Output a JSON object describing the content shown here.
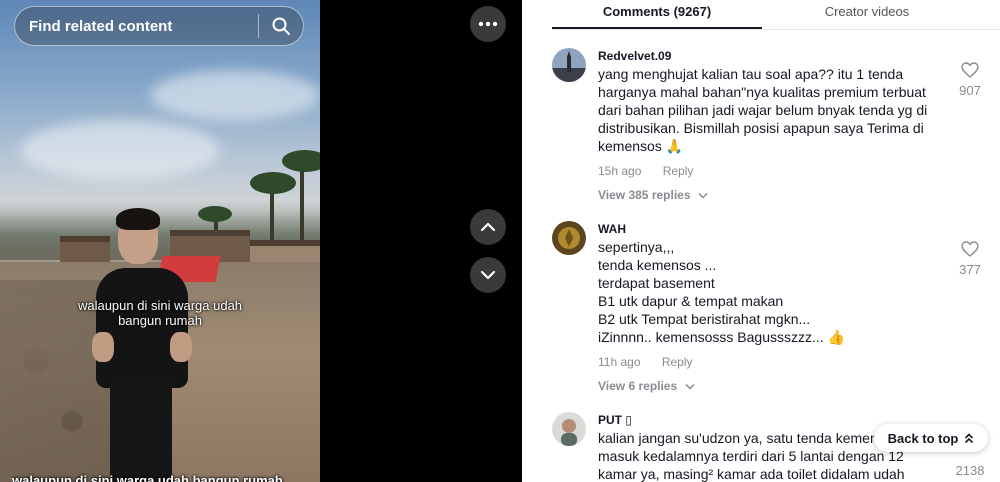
{
  "video": {
    "search_placeholder": "Find related content",
    "caption_overlay": "walaupun di sini warga udah\nbangun rumah",
    "caption_bottom": "walaupun di sini warga udah bangun rumah"
  },
  "tabs": [
    {
      "label": "Comments (9267)",
      "active": true
    },
    {
      "label": "Creator videos",
      "active": false
    }
  ],
  "comments": [
    {
      "user": "Redvelvet.09",
      "text": "yang menghujat kalian tau soal apa?? itu 1 tenda harganya mahal bahan\"nya kualitas premium terbuat dari bahan pilihan jadi wajar belum bnyak tenda yg di distribusikan. Bismillah posisi apapun saya Terima di kemensos 🙏",
      "time": "15h ago",
      "reply_label": "Reply",
      "view_replies": "View 385 replies",
      "likes": "907"
    },
    {
      "user": "WAH",
      "text": "sepertinya,,,\ntenda kemensos ...\nterdapat basement\nB1 utk dapur & tempat makan\nB2 utk Tempat beristirahat mgkn...\niZinnnn.. kemensosss Bagussszzz... 👍",
      "time": "11h ago",
      "reply_label": "Reply",
      "view_replies": "View 6 replies",
      "likes": "377"
    },
    {
      "user": "PUT ▯",
      "text": "kalian jangan su'udzon ya, satu tenda kemensos pas masuk kedalamnya terdiri dari 5 lantai dengan 12 kamar ya, masing² kamar ada toilet didalam udah",
      "likes": "2138"
    }
  ],
  "back_to_top": "Back to top"
}
